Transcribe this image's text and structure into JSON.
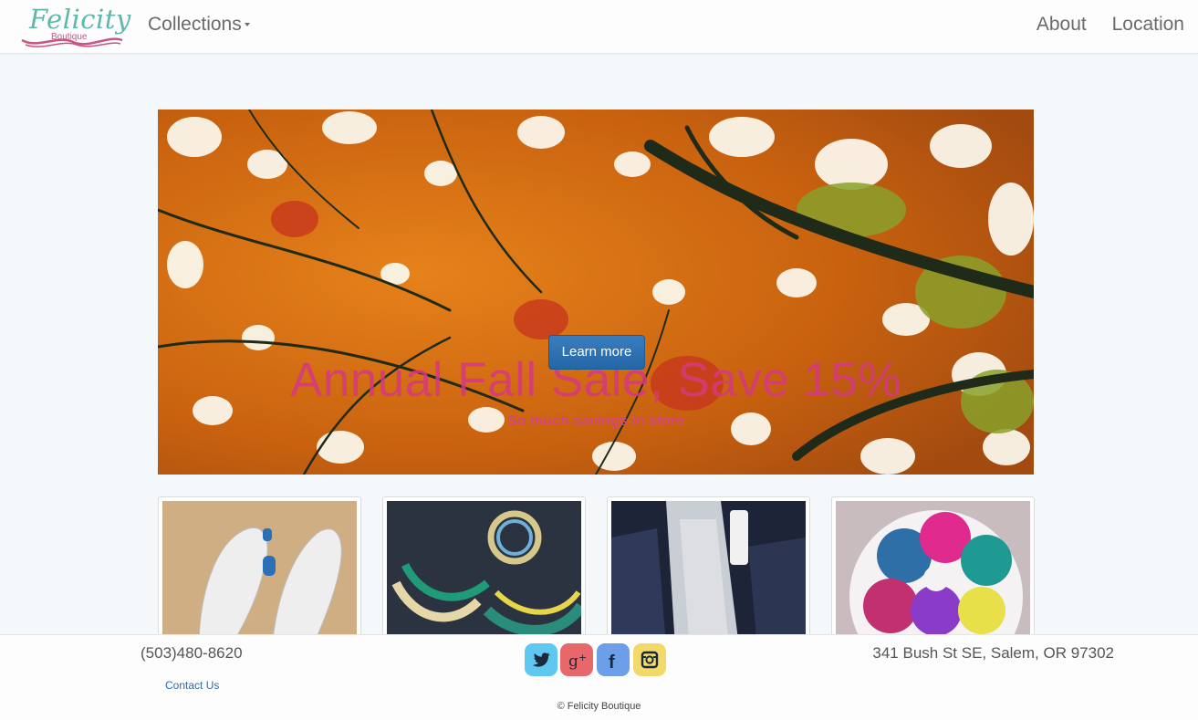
{
  "brand": {
    "name": "Felicity",
    "sub": "Boutique"
  },
  "nav": {
    "collections": "Collections",
    "about": "About",
    "location": "Location"
  },
  "hero": {
    "title": "Annual Fall Sale, Save 15%",
    "subtitle": "So much savings in store",
    "button": "Learn more"
  },
  "thumbnails": [
    {
      "name": "white sandals"
    },
    {
      "name": "beaded necklaces"
    },
    {
      "name": "denim and lace clothing"
    },
    {
      "name": "patterned bibs"
    }
  ],
  "footer": {
    "phone": "(503)480-8620",
    "contact": "Contact Us",
    "address": "341 Bush St SE, Salem, OR 97302",
    "copyright": "© Felicity Boutique",
    "social": [
      "twitter-icon",
      "google-plus-icon",
      "facebook-icon",
      "instagram-icon"
    ]
  },
  "colors": {
    "accent_pink": "#d6457c",
    "button_blue": "#2466a6",
    "twitter": "#5fc8f0",
    "google": "#e8676b",
    "facebook": "#6d9ee8",
    "instagram": "#f2d96a"
  }
}
